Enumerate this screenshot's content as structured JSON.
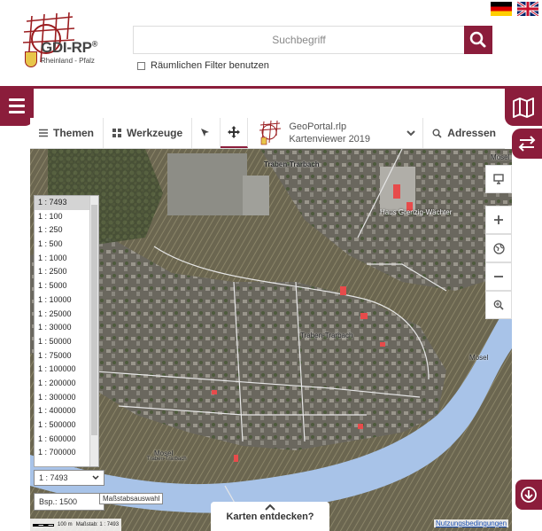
{
  "header": {
    "logo_title": "GDI-RP",
    "logo_reg": "®",
    "logo_subtitle": "Rheinland - Pfalz",
    "search_placeholder": "Suchbegriff",
    "spatial_filter_label": "Räumlichen Filter benutzen"
  },
  "toolbar": {
    "themes_label": "Themen",
    "tools_label": "Werkzeuge",
    "viewer_line1": "GeoPortal.rlp",
    "viewer_line2": "Kartenviewer 2019",
    "address_label": "Adressen"
  },
  "map": {
    "labels": {
      "town_top": "Traben-Trarbach",
      "town_center": "Traben-Trarbach",
      "river_right": "Mosel",
      "river_bottom": "Mosel",
      "river_bottom_sub": "Traben-Trarbach",
      "river_top_right": "Mosel",
      "building_label": "Haus Grenzig-Wächter"
    }
  },
  "scale": {
    "options": [
      "1 : 7493",
      "1 : 100",
      "1 : 250",
      "1 : 500",
      "1 : 1000",
      "1 : 2500",
      "1 : 5000",
      "1 : 10000",
      "1 : 25000",
      "1 : 30000",
      "1 : 50000",
      "1 : 75000",
      "1 : 100000",
      "1 : 200000",
      "1 : 300000",
      "1 : 400000",
      "1 : 500000",
      "1 : 600000",
      "1 : 700000"
    ],
    "selected": "1 : 7493",
    "tooltip": "Maßstabsauswahl",
    "example": "Bsp.: 1500"
  },
  "discover_label": "Karten entdecken?",
  "footer": {
    "scale_bar_label": "100 m",
    "scale_text": "Maßstab: 1 : 7493",
    "terms_label": "Nutzungsbedingungen"
  },
  "colors": {
    "brand": "#8b1d3b"
  }
}
